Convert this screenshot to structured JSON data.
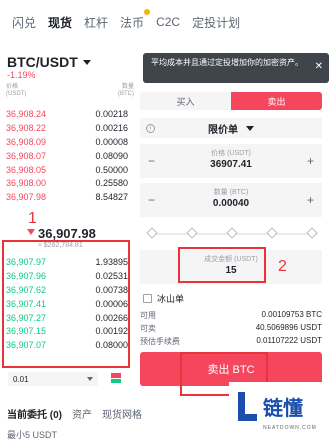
{
  "tabs": [
    {
      "label": "闪兑",
      "active": false
    },
    {
      "label": "现货",
      "active": true
    },
    {
      "label": "杠杆",
      "active": false
    },
    {
      "label": "法币",
      "active": false,
      "dot": true
    },
    {
      "label": "C2C",
      "active": false
    },
    {
      "label": "定投计划",
      "active": false
    }
  ],
  "pair": "BTC/USDT",
  "change": "-1.19%",
  "orderbook": {
    "price_header": "价格",
    "price_unit": "(USDT)",
    "qty_header": "数量",
    "qty_unit": "(BTC)",
    "asks": [
      {
        "price": "36,908.24",
        "qty": "0.00218"
      },
      {
        "price": "36,908.22",
        "qty": "0.00216"
      },
      {
        "price": "36,908.09",
        "qty": "0.00008"
      },
      {
        "price": "36,908.07",
        "qty": "0.08090"
      },
      {
        "price": "36,908.05",
        "qty": "0.50000"
      },
      {
        "price": "36,908.00",
        "qty": "0.25580"
      },
      {
        "price": "36,907.98",
        "qty": "8.54827"
      }
    ],
    "last_price": "36,907.98",
    "last_price_usd": "≈ $262,784.81",
    "bids": [
      {
        "price": "36,907.97",
        "qty": "1.93895"
      },
      {
        "price": "36,907.96",
        "qty": "0.02531"
      },
      {
        "price": "36,907.62",
        "qty": "0.00738"
      },
      {
        "price": "36,907.41",
        "qty": "0.00006"
      },
      {
        "price": "36,907.27",
        "qty": "0.00266"
      },
      {
        "price": "36,907.15",
        "qty": "0.00192"
      },
      {
        "price": "36,907.07",
        "qty": "0.08000"
      }
    ],
    "depth": "0.01"
  },
  "annotations": {
    "one": "1",
    "two": "2"
  },
  "tooltip": {
    "text": "平均成本并且通过定投增加你的加密资产。",
    "close": "✕"
  },
  "trade": {
    "buy_label": "买入",
    "sell_label": "卖出",
    "order_type": "限价单",
    "price_label": "价格 (USDT)",
    "price_value": "36907.41",
    "qty_label": "数量 (BTC)",
    "qty_value": "0.00040",
    "amount_label": "成交金额 (USDT)",
    "amount_value": "15",
    "iceberg_label": "冰山单",
    "available_label": "可用",
    "available_value": "0.00109753 BTC",
    "can_sell_label": "可卖",
    "can_sell_value": "40.5069896 USDT",
    "fee_label": "预估手续费",
    "fee_value": "0.01107222 USDT",
    "submit_label": "卖出 BTC"
  },
  "bottom_tabs": [
    "当前委托 (0)",
    "资产",
    "现货网格"
  ],
  "min_label": "最小5 USDT",
  "logo": {
    "cn": "链懂",
    "en": "NEATDOWN.COM"
  },
  "colors": {
    "red": "#f6465d",
    "green": "#0ecb81",
    "annotation": "#e8333b",
    "brand_blue": "#1a4fae"
  }
}
